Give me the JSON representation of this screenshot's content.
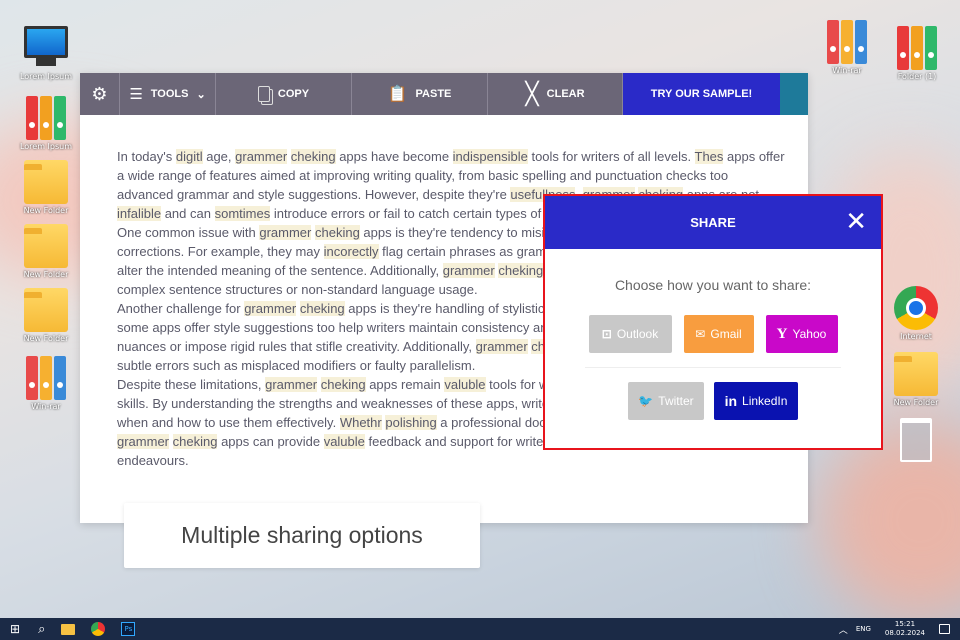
{
  "desktop": {
    "left_icons": [
      "Lorem Ipsum",
      "Lorem Ipsum",
      "New Folder",
      "New Folder",
      "New Folder",
      "Win-rar"
    ],
    "right_top_icons": [
      "Win-rar",
      "Folder (1)"
    ],
    "right_icons": [
      "Internet",
      "New Folder"
    ]
  },
  "toolbar": {
    "tools": "TOOLS",
    "copy": "COPY",
    "paste": "PASTE",
    "clear": "CLEAR",
    "try_sample": "TRY OUR SAMPLE!"
  },
  "editor": {
    "lines": [
      [
        [
          "In today's ",
          0
        ],
        [
          "digitl",
          1
        ],
        [
          " age, ",
          0
        ],
        [
          "grammer",
          1
        ],
        [
          " ",
          0
        ],
        [
          "cheking",
          1
        ],
        [
          " apps have become ",
          0
        ],
        [
          "indispensible",
          1
        ],
        [
          " tools for writers of all levels. ",
          0
        ],
        [
          "Thes",
          1
        ],
        [
          " apps offer",
          0
        ]
      ],
      [
        [
          "a wide range of features aimed at improving writing quality, from basic spelling and punctuation checks too",
          0
        ]
      ],
      [
        [
          "advanced grammar and style suggestions. However, despite they're ",
          0
        ],
        [
          "usefullness",
          1
        ],
        [
          ", ",
          0
        ],
        [
          "grammer",
          1
        ],
        [
          " ",
          0
        ],
        [
          "cheking",
          1
        ],
        [
          " apps are not",
          0
        ]
      ],
      [
        [
          "infalible",
          1
        ],
        [
          " and can ",
          0
        ],
        [
          "somtimes",
          1
        ],
        [
          " introduce errors or fail to catch certain types of m",
          0
        ]
      ],
      [
        [
          "One common issue with ",
          0
        ],
        [
          "grammer",
          1
        ],
        [
          " ",
          0
        ],
        [
          "cheking",
          1
        ],
        [
          " apps is they're tendency to misin",
          0
        ]
      ],
      [
        [
          "corrections. For example, they may ",
          0
        ],
        [
          "incorectly",
          1
        ],
        [
          " flag certain phrases as gramm",
          0
        ]
      ],
      [
        [
          "alter the intended meaning of the sentence. Additionally, ",
          0
        ],
        [
          "grammer",
          1
        ],
        [
          " ",
          0
        ],
        [
          "cheking",
          1
        ]
      ],
      [
        [
          "complex sentence structures or non-standard language usage.",
          0
        ]
      ],
      [
        [
          "Another challenge for ",
          0
        ],
        [
          "grammer",
          1
        ],
        [
          " ",
          0
        ],
        [
          "cheking",
          1
        ],
        [
          " apps is they're handling of stylistic",
          0
        ]
      ],
      [
        [
          "some apps offer style suggestions too help writers maintain consistency and",
          0
        ]
      ],
      [
        [
          "nuances or impose rigid rules that stifle creativity. Additionally, ",
          0
        ],
        [
          "grammer",
          1
        ],
        [
          " ",
          0
        ],
        [
          "che",
          1
        ]
      ],
      [
        [
          "subtle errors such as misplaced modifiers or faulty parallelism.",
          0
        ]
      ],
      [
        [
          "Despite these limitations, ",
          0
        ],
        [
          "grammer",
          1
        ],
        [
          " ",
          0
        ],
        [
          "cheking",
          1
        ],
        [
          " apps remain ",
          0
        ],
        [
          "valuble",
          1
        ],
        [
          " tools for wr",
          0
        ]
      ],
      [
        [
          "skills. By understanding the strengths and weaknesses of these apps, writers",
          0
        ]
      ],
      [
        [
          "when and how to use them effectively. ",
          0
        ],
        [
          "Whethr",
          1
        ],
        [
          " ",
          0
        ],
        [
          "polishing",
          1
        ],
        [
          " a professional docu",
          0
        ]
      ],
      [
        [
          "grammer",
          1
        ],
        [
          " ",
          0
        ],
        [
          "cheking",
          1
        ],
        [
          " apps can provide ",
          0
        ],
        [
          "valuble",
          1
        ],
        [
          " feedback and support for writers",
          0
        ]
      ],
      [
        [
          "endeavours.",
          0
        ]
      ]
    ]
  },
  "share": {
    "title": "SHARE",
    "prompt": "Choose how you want to share:",
    "buttons": [
      {
        "label": "Outlook",
        "color": "#c8c8c8"
      },
      {
        "label": "Gmail",
        "color": "#f89d3f"
      },
      {
        "label": "Yahoo",
        "color": "#c908c9"
      },
      {
        "label": "Twitter",
        "color": "#c8c8c8"
      },
      {
        "label": "LinkedIn",
        "color": "#0a12b0"
      }
    ]
  },
  "caption": "Multiple sharing options",
  "taskbar": {
    "lang": "ENG",
    "time": "15:21",
    "date": "08.02.2024"
  }
}
